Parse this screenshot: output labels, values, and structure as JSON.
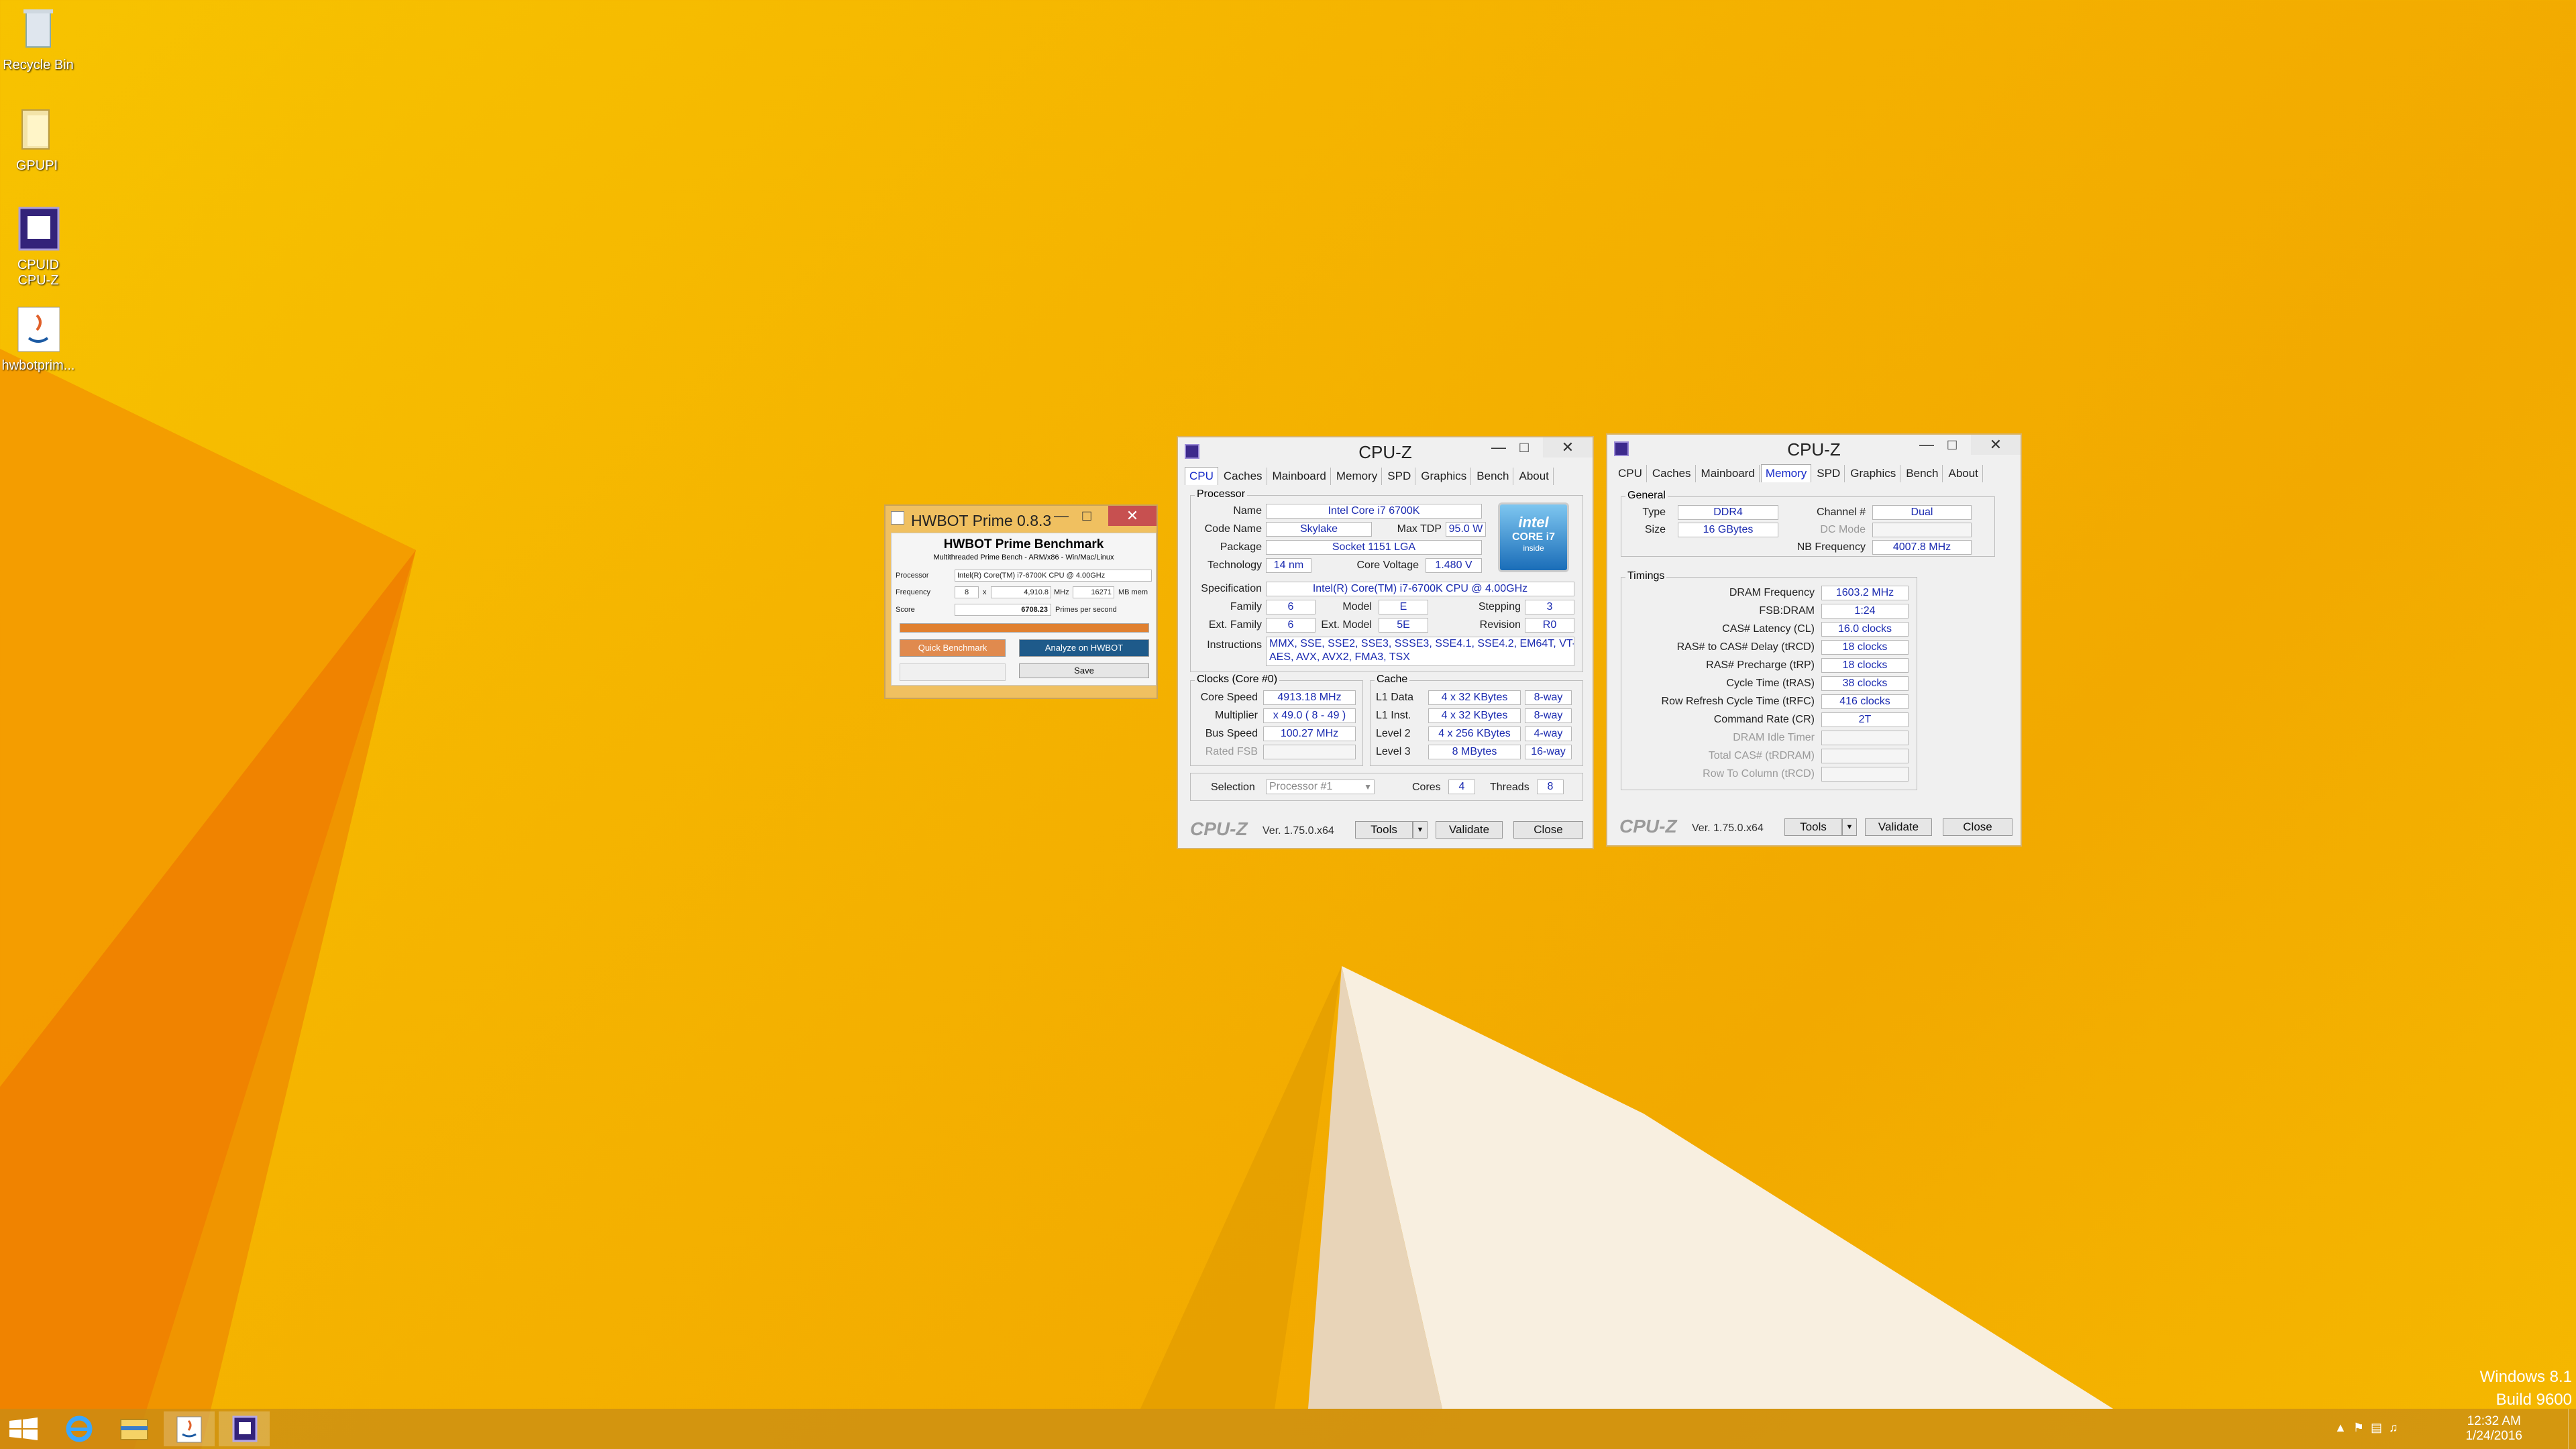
{
  "desktop": {
    "icons": [
      {
        "label": "Recycle Bin",
        "icon": "recycle-bin-icon"
      },
      {
        "label": "GPUPI",
        "icon": "folder-icon"
      },
      {
        "label": "CPUID CPU-Z",
        "icon": "cpuz-icon"
      },
      {
        "label": "hwbotprim...",
        "icon": "java-icon"
      }
    ],
    "watermark": {
      "line1": "Windows 8.1",
      "line2": "Build 9600"
    },
    "accent": "#f5b400"
  },
  "taskbar": {
    "clock": {
      "time": "12:32 AM",
      "date": "1/24/2016"
    },
    "buttons": [
      "start-icon",
      "ie-icon",
      "explorer-icon",
      "java-icon",
      "cpuz-icon"
    ]
  },
  "hwbot": {
    "title": "HWBOT Prime 0.8.3",
    "heading": "HWBOT Prime Benchmark",
    "subheading": "Multithreaded Prime Bench - ARM/x86 - Win/Mac/Linux",
    "processor_label": "Processor",
    "processor_value": "Intel(R) Core(TM) i7-6700K CPU @ 4.00GHz",
    "frequency_label": "Frequency",
    "threads": "8",
    "x_label": "x",
    "frequency_value": "4,910.8",
    "mhz_label": "MHz",
    "mem_value": "16271",
    "mem_label": "MB mem",
    "score_label": "Score",
    "score_value": "6708.23",
    "score_unit": "Primes per second",
    "progress": 1.0,
    "quick_label": "Quick Benchmark",
    "analyze_label": "Analyze on HWBOT",
    "save_label": "Save"
  },
  "cpuz1": {
    "title": "CPU-Z",
    "tabs": [
      "CPU",
      "Caches",
      "Mainboard",
      "Memory",
      "SPD",
      "Graphics",
      "Bench",
      "About"
    ],
    "selected_tab": "CPU",
    "processor_group": "Processor",
    "name_label": "Name",
    "name": "Intel Core i7 6700K",
    "codename_label": "Code Name",
    "codename": "Skylake",
    "maxtdp_label": "Max TDP",
    "maxtdp": "95.0 W",
    "package_label": "Package",
    "package": "Socket 1151 LGA",
    "technology_label": "Technology",
    "technology": "14 nm",
    "corevoltage_label": "Core Voltage",
    "corevoltage": "1.480 V",
    "spec_label": "Specification",
    "spec": "Intel(R) Core(TM) i7-6700K CPU @ 4.00GHz",
    "family_label": "Family",
    "family": "6",
    "model_label": "Model",
    "model": "E",
    "stepping_label": "Stepping",
    "stepping": "3",
    "extfamily_label": "Ext. Family",
    "extfamily": "6",
    "extmodel_label": "Ext. Model",
    "extmodel": "5E",
    "revision_label": "Revision",
    "revision": "R0",
    "instructions_label": "Instructions",
    "instructions_line1": "MMX, SSE, SSE2, SSE3, SSSE3, SSE4.1, SSE4.2, EM64T, VT-x,",
    "instructions_line2": "AES, AVX, AVX2, FMA3, TSX",
    "logo": {
      "line1": "intel",
      "line2": "CORE i7",
      "line3": "inside"
    },
    "clocks_group": "Clocks (Core #0)",
    "corespeed_label": "Core Speed",
    "corespeed": "4913.18 MHz",
    "multiplier_label": "Multiplier",
    "multiplier": "x 49.0 ( 8 - 49 )",
    "busspeed_label": "Bus Speed",
    "busspeed": "100.27 MHz",
    "ratedfsb_label": "Rated FSB",
    "cache_group": "Cache",
    "l1data_label": "L1 Data",
    "l1data": "4 x 32 KBytes",
    "l1data_way": "8-way",
    "l1inst_label": "L1 Inst.",
    "l1inst": "4 x 32 KBytes",
    "l1inst_way": "8-way",
    "l2_label": "Level 2",
    "l2": "4 x 256 KBytes",
    "l2_way": "4-way",
    "l3_label": "Level 3",
    "l3": "8 MBytes",
    "l3_way": "16-way",
    "selection_label": "Selection",
    "selection": "Processor #1",
    "cores_label": "Cores",
    "cores": "4",
    "threads_label": "Threads",
    "threads": "8",
    "footer_logo": "CPU-Z",
    "version": "Ver. 1.75.0.x64",
    "tools_label": "Tools",
    "validate_label": "Validate",
    "close_label": "Close"
  },
  "cpuz2": {
    "title": "CPU-Z",
    "tabs": [
      "CPU",
      "Caches",
      "Mainboard",
      "Memory",
      "SPD",
      "Graphics",
      "Bench",
      "About"
    ],
    "selected_tab": "Memory",
    "general_group": "General",
    "type_label": "Type",
    "type": "DDR4",
    "channel_label": "Channel #",
    "channel": "Dual",
    "size_label": "Size",
    "size": "16 GBytes",
    "dcmode_label": "DC Mode",
    "nbfreq_label": "NB Frequency",
    "nbfreq": "4007.8 MHz",
    "timings_group": "Timings",
    "dramfreq_label": "DRAM Frequency",
    "dramfreq": "1603.2 MHz",
    "fsbdram_label": "FSB:DRAM",
    "fsbdram": "1:24",
    "cl_label": "CAS# Latency (CL)",
    "cl": "16.0 clocks",
    "trcd_label": "RAS# to CAS# Delay (tRCD)",
    "trcd": "18 clocks",
    "trp_label": "RAS# Precharge (tRP)",
    "trp": "18 clocks",
    "tras_label": "Cycle Time (tRAS)",
    "tras": "38 clocks",
    "trfc_label": "Row Refresh Cycle Time (tRFC)",
    "trfc": "416 clocks",
    "cr_label": "Command Rate (CR)",
    "cr": "2T",
    "idle_label": "DRAM Idle Timer",
    "trdram_label": "Total CAS# (tRDRAM)",
    "trcd2_label": "Row To Column (tRCD)",
    "footer_logo": "CPU-Z",
    "version": "Ver. 1.75.0.x64",
    "tools_label": "Tools",
    "validate_label": "Validate",
    "close_label": "Close"
  }
}
